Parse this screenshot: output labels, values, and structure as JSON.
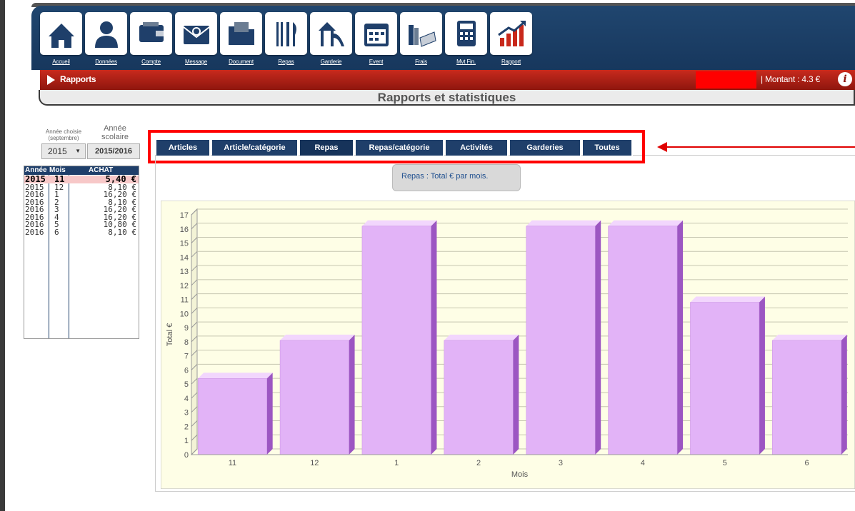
{
  "nav": {
    "items": [
      {
        "label": "Accueil",
        "icon": "home-icon"
      },
      {
        "label": "Données",
        "icon": "user-icon"
      },
      {
        "label": "Compte",
        "icon": "wallet-icon"
      },
      {
        "label": "Message",
        "icon": "envelope-icon"
      },
      {
        "label": "Document",
        "icon": "folder-icon"
      },
      {
        "label": "Repas",
        "icon": "cutlery-icon"
      },
      {
        "label": "Garderie",
        "icon": "playground-icon"
      },
      {
        "label": "Event",
        "icon": "calendar-icon"
      },
      {
        "label": "Frais",
        "icon": "books-icon"
      },
      {
        "label": "Mvt Fin.",
        "icon": "calculator-icon"
      },
      {
        "label": "Rapport",
        "icon": "growth-chart-icon"
      }
    ]
  },
  "breadcrumb": {
    "current": "Rapports"
  },
  "account": {
    "amount_label": "| Montant : 4.3 €",
    "info_icon": "info-icon"
  },
  "page": {
    "title": "Rapports et statistiques"
  },
  "filters": {
    "year_label": "Année choisie (septembre)",
    "year_value": "2015",
    "school_year_label": "Année scolaire",
    "school_year_value": "2015/2016"
  },
  "table": {
    "headers": [
      "Année",
      "Mois",
      "ACHAT"
    ],
    "rows": [
      {
        "year": "2015",
        "month": "11",
        "value": "5,40 €",
        "selected": true
      },
      {
        "year": "2015",
        "month": "12",
        "value": "8,10 €"
      },
      {
        "year": "2016",
        "month": "1",
        "value": "16,20 €"
      },
      {
        "year": "2016",
        "month": "2",
        "value": "8,10 €"
      },
      {
        "year": "2016",
        "month": "3",
        "value": "16,20 €"
      },
      {
        "year": "2016",
        "month": "4",
        "value": "16,20 €"
      },
      {
        "year": "2016",
        "month": "5",
        "value": "10,80 €"
      },
      {
        "year": "2016",
        "month": "6",
        "value": "8,10 €"
      }
    ]
  },
  "tabs": [
    {
      "label": "Articles",
      "active": false
    },
    {
      "label": "Article/catégorie",
      "active": false
    },
    {
      "label": "Repas",
      "active": true
    },
    {
      "label": "Repas/catégorie",
      "active": false
    },
    {
      "label": "Activités",
      "active": false
    },
    {
      "label": "Garderies",
      "active": false
    },
    {
      "label": "Toutes",
      "active": false
    }
  ],
  "chart_note": "Repas : Total € par mois.",
  "colors": {
    "navy": "#1f3f6a",
    "red": "#c82a1d",
    "bar_front": "#e2b3f7",
    "bar_side": "#9c56c2",
    "plot_bg": "#fefee6"
  },
  "chart_data": {
    "type": "bar",
    "categories": [
      "11",
      "12",
      "1",
      "2",
      "3",
      "4",
      "5",
      "6"
    ],
    "values": [
      5.4,
      8.1,
      16.2,
      8.1,
      16.2,
      16.2,
      10.8,
      8.1
    ],
    "title": "",
    "xlabel": "Mois",
    "ylabel": "Total €",
    "ylim": [
      0,
      17
    ],
    "yticks": [
      0,
      1,
      2,
      3,
      4,
      5,
      6,
      7,
      8,
      9,
      10,
      11,
      12,
      13,
      14,
      15,
      16,
      17
    ],
    "grid": true,
    "style": "3d"
  }
}
